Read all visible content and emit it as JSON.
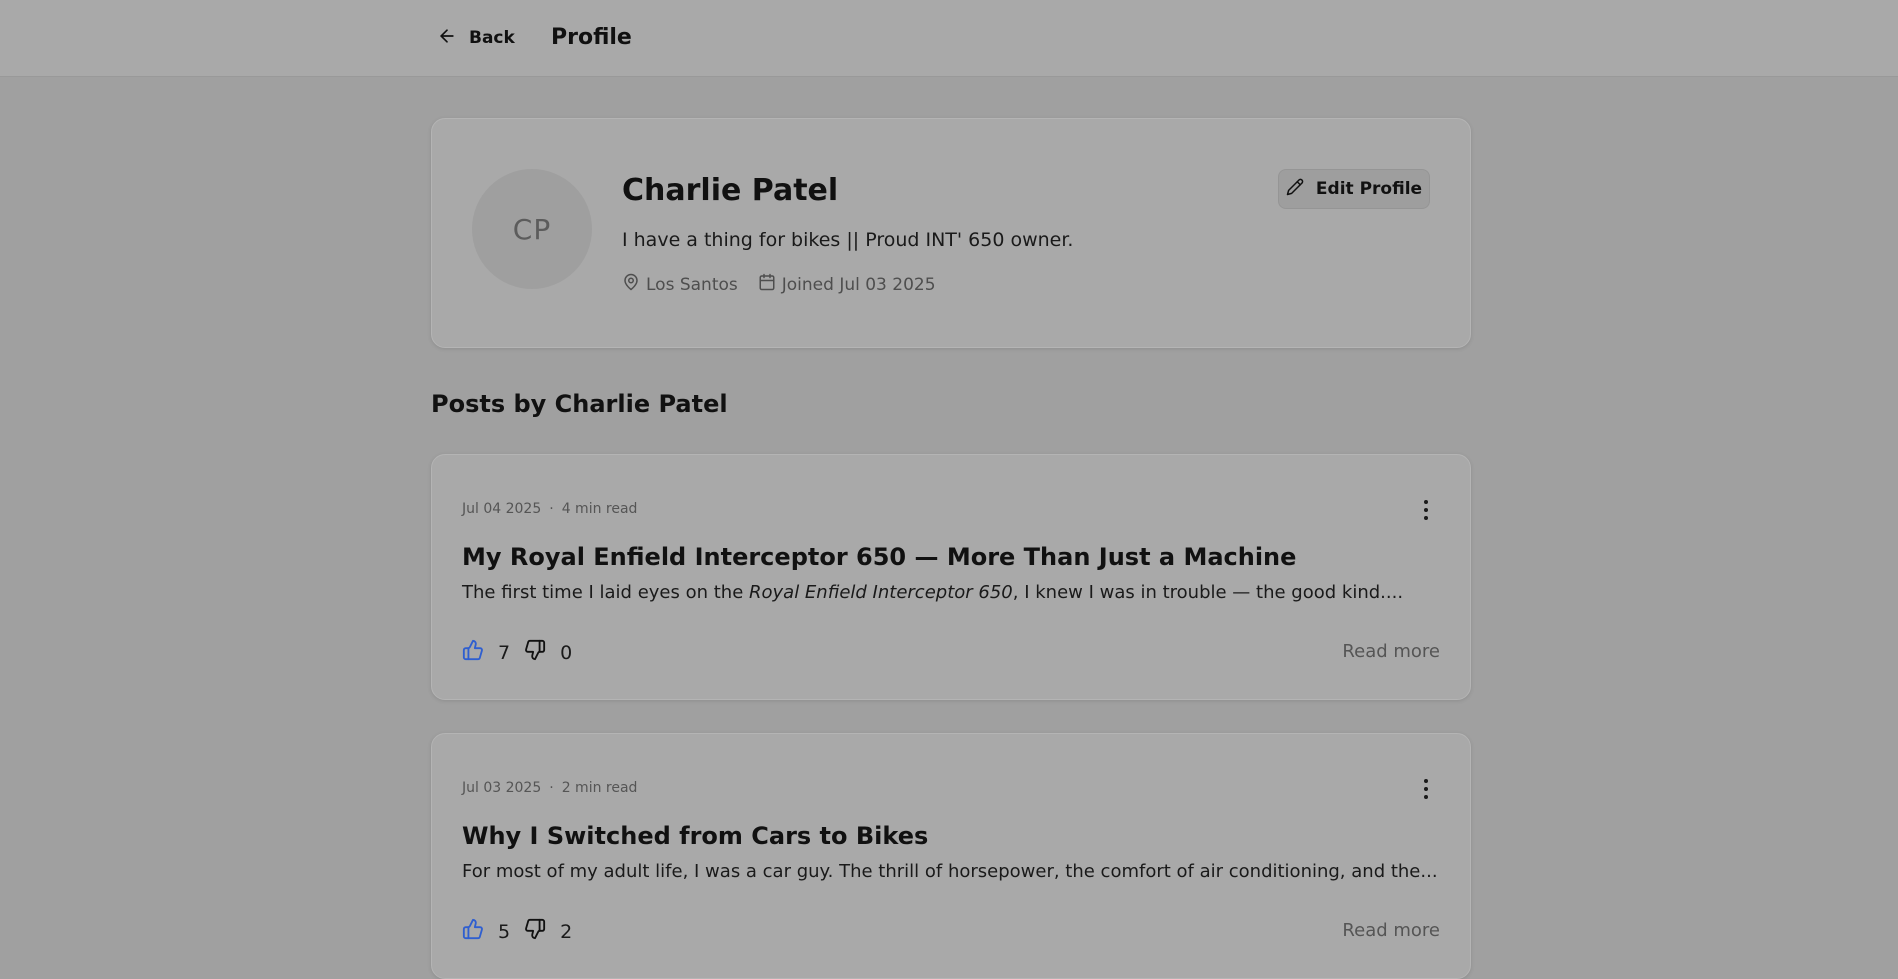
{
  "header": {
    "back_label": "Back",
    "title": "Profile"
  },
  "profile": {
    "initials": "CP",
    "name": "Charlie Patel",
    "bio": "I have a thing for bikes || Proud INT' 650 owner.",
    "location": "Los Santos",
    "joined": "Joined Jul 03 2025",
    "edit_label": "Edit Profile"
  },
  "posts_section": {
    "title": "Posts by Charlie Patel"
  },
  "posts": [
    {
      "date": "Jul 04 2025",
      "separator": "·",
      "read_time": "4 min read",
      "title": "My Royal Enfield Interceptor 650 — More Than Just a Machine",
      "excerpt_before": "The first time I laid eyes on the ",
      "excerpt_em": "Royal Enfield Interceptor 650",
      "excerpt_after": ", I knew I was in trouble — the good kind....",
      "likes": "7",
      "dislikes": "0",
      "read_more": "Read more"
    },
    {
      "date": "Jul 03 2025",
      "separator": "·",
      "read_time": "2 min read",
      "title": "Why I Switched from Cars to Bikes",
      "excerpt_before": "For most of my adult life, I was a car guy. The thrill of horsepower, the comfort of air conditioning, and the...",
      "excerpt_em": "",
      "excerpt_after": "",
      "likes": "5",
      "dislikes": "2",
      "read_more": "Read more"
    }
  ],
  "icons": {
    "back": "arrow-left-icon",
    "edit": "pencil-icon",
    "location": "map-pin-icon",
    "calendar": "calendar-icon",
    "like": "thumbs-up-icon",
    "dislike": "thumbs-down-icon",
    "more": "kebab-menu-icon"
  },
  "colors": {
    "like_icon": "#2f5fd0",
    "background": "#a0a0a0",
    "card": "#a9a9a9"
  }
}
